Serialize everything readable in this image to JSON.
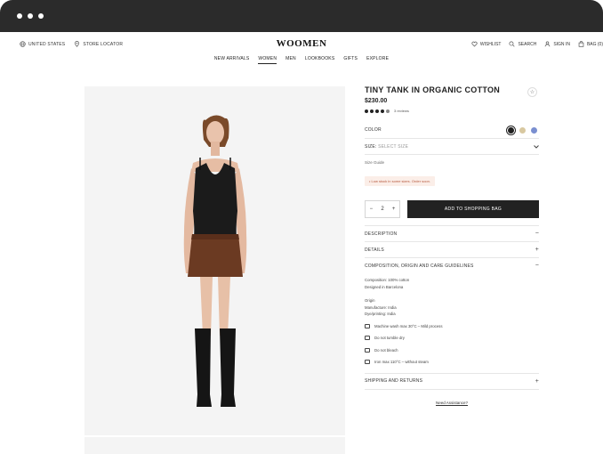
{
  "header": {
    "left_items": [
      {
        "label": "UNITED STATES",
        "icon": "globe-icon"
      },
      {
        "label": "STORE LOCATOR",
        "icon": "location-pin-icon"
      }
    ],
    "logo": "WOOMEN",
    "right_items": [
      {
        "label": "WISHLIST",
        "icon": "heart-icon"
      },
      {
        "label": "SEARCH",
        "icon": "search-icon"
      },
      {
        "label": "SIGN IN",
        "icon": "user-icon"
      },
      {
        "label": "BAG (0)",
        "icon": "bag-icon"
      }
    ],
    "nav": [
      "NEW ARRIVALS",
      "WOMEN",
      "MEN",
      "LOOKBOOKS",
      "GIFTS",
      "EXPLORE"
    ],
    "nav_active": "WOMEN"
  },
  "product": {
    "title": "TINY TANK IN ORGANIC COTTON",
    "price": "$230.00",
    "rating": 4.5,
    "reviews_label": "3 reviews",
    "color_label": "COLOR",
    "colors": [
      "#1f1f1f",
      "#d8c8a0",
      "#7a8fd0"
    ],
    "selected_color_index": 0,
    "size_label": "SIZE:",
    "size_placeholder": "SELECT SIZE",
    "size_guide": "Size Guide",
    "stock_notice": "• Low stock in some sizes. Order soon.",
    "quantity": "2",
    "qty_minus": "−",
    "qty_plus": "+",
    "add_to_bag": "ADD TO SHOPPING BAG"
  },
  "accordion": {
    "description": {
      "label": "DESCRIPTION",
      "sign": "−"
    },
    "details": {
      "label": "DETAILS",
      "sign": "+"
    },
    "composition": {
      "label": "COMPOSITION, ORIGIN AND CARE GUIDELINES",
      "sign": "−"
    },
    "composition_lines": [
      "Composition: 100% cotton",
      "Designed in Barcelona"
    ],
    "origin_lines": [
      "Origin",
      "Manufacture: India",
      "Dye/printing: India"
    ],
    "care_items": [
      "Machine wash max 30°C – Mild process",
      "Do not tumble dry",
      "Do not bleach",
      "Iron max 110°C – without steam"
    ],
    "shipping": {
      "label": "SHIPPING AND RETURNS",
      "sign": "+"
    }
  },
  "need_assistance": "Need Assistance?"
}
